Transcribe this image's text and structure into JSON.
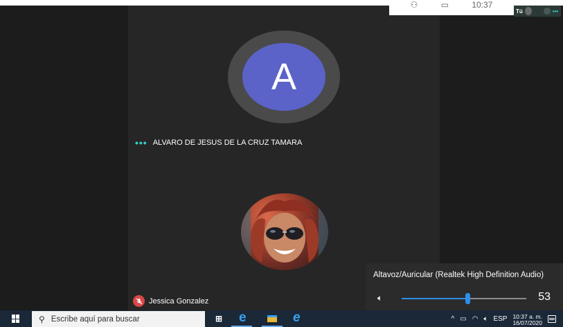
{
  "top_bar": {
    "time": "10:37",
    "self_label": "Tú"
  },
  "call": {
    "avatar_initial": "A",
    "active_speaker": "ALVARO DE JESUS DE LA CRUZ TAMARA",
    "speaking_indicator": "•••",
    "self_name": "Jessica Gonzalez"
  },
  "volume_flyout": {
    "device": "Altavoz/Auricular (Realtek High Definition Audio)",
    "volume_value": "53",
    "volume_level": 53
  },
  "taskbar": {
    "search_placeholder": "Escribe aquí para buscar",
    "language": "ESP",
    "time": "10:37 a. m.",
    "date": "16/07/2020"
  },
  "colors": {
    "accent": "#2e8ee8",
    "avatar": "#5b63c9",
    "speaking_dots": "#33d1c4",
    "mute_badge": "#d84848",
    "taskbar": "#1a2838"
  }
}
